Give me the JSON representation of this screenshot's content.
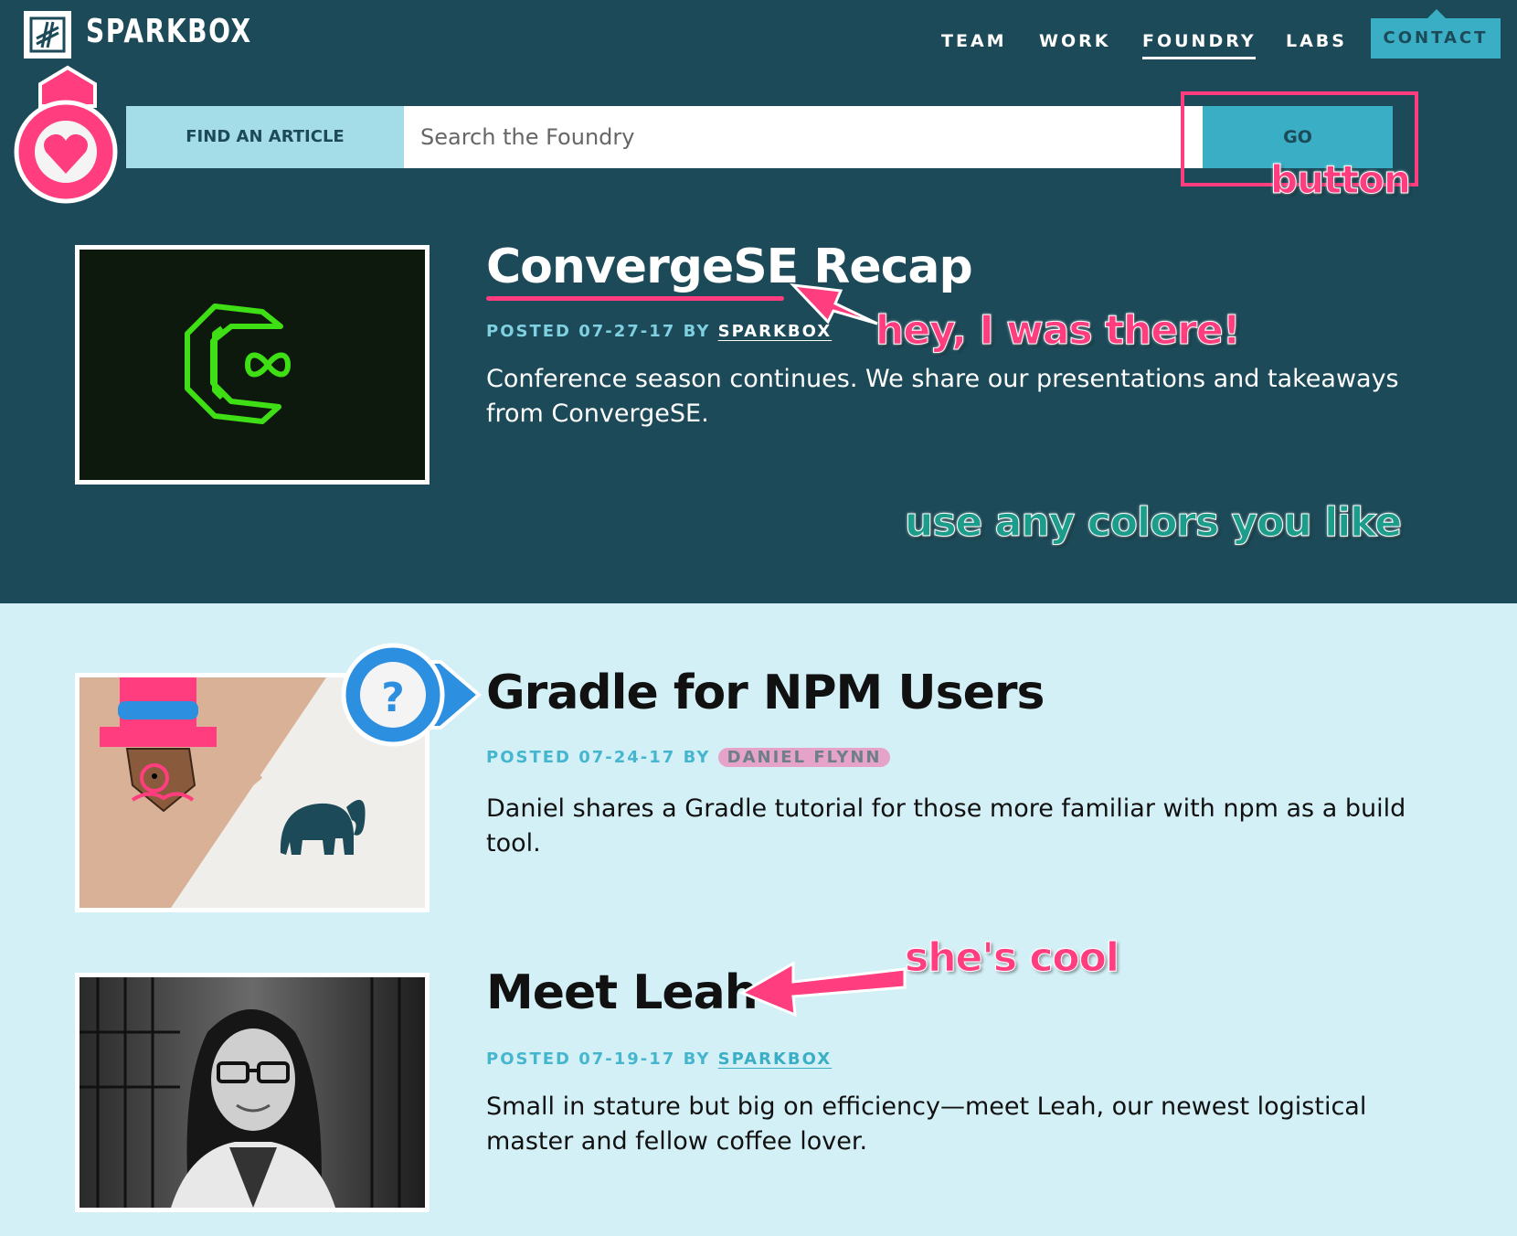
{
  "header": {
    "logo_text": "SPARKBOX",
    "nav": [
      {
        "label": "TEAM"
      },
      {
        "label": "WORK"
      },
      {
        "label": "FOUNDRY"
      },
      {
        "label": "LABS"
      },
      {
        "label": "CONTACT"
      }
    ],
    "active_nav": "FOUNDRY"
  },
  "search": {
    "find_label": "FIND AN ARTICLE",
    "placeholder": "Search the Foundry",
    "go_label": "GO"
  },
  "articles": [
    {
      "title": "ConvergeSE Recap",
      "posted_prefix": "POSTED 07-27-17 BY",
      "author": "SPARKBOX",
      "excerpt": "Conference season continues. We share our presentations and takeaways from ConvergeSE."
    },
    {
      "title": "Gradle for NPM Users",
      "posted_prefix": "POSTED 07-24-17 BY",
      "author": "DANIEL FLYNN",
      "excerpt": "Daniel shares a Gradle tutorial for those more familiar with npm as a build tool."
    },
    {
      "title": "Meet Leah",
      "posted_prefix": "POSTED 07-19-17 BY",
      "author": "SPARKBOX",
      "excerpt": "Small in stature but big on efficiency—meet Leah, our newest logistical master and fellow coffee lover."
    }
  ],
  "annotations": {
    "button": "button",
    "there": "hey, I was there!",
    "colors": "use any colors you like",
    "cool": "she's cool"
  },
  "icons": [
    "sparkbox-logo-icon",
    "heart-pin-icon",
    "question-pin-icon",
    "converge-logo-icon",
    "elephant-icon",
    "arrow-icon"
  ],
  "colors": {
    "hero_bg": "#1c4a58",
    "page_bg": "#d3f0f7",
    "accent_teal": "#3aaec4",
    "annotation_pink": "#ff3d7f"
  }
}
